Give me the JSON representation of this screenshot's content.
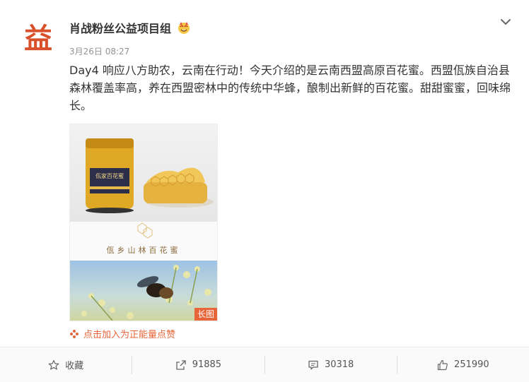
{
  "post": {
    "username": "肖战粉丝公益项目组",
    "avatar_char": "益",
    "timestamp": "3月26日 08:27",
    "text": "Day4 响应八方助农，云南在行动！今天介绍的是云南西盟高原百花蜜。西盟佤族自治县森林覆盖率高，养在西盟密林中的传统中华蜂，酿制出新鲜的百花蜜。甜甜蜜蜜，回味绵长。",
    "image": {
      "jar_label": "佤家百花蜜",
      "caption": "佤乡山林百花蜜",
      "long_image_tag": "长图"
    },
    "positive_energy_link": "点击加入为正能量点赞"
  },
  "actions": {
    "favorite_label": "收藏",
    "repost_count": "91885",
    "comment_count": "30318",
    "like_count": "251990"
  },
  "colors": {
    "accent": "#e8653a",
    "text": "#333333",
    "muted": "#939393"
  },
  "icons": {
    "menu": "chevron-down-icon",
    "favorite": "star-icon",
    "repost": "repost-icon",
    "comment": "comment-icon",
    "like": "thumbs-up-icon",
    "positive": "flower-icon",
    "badge": "emoji-badge-icon"
  }
}
